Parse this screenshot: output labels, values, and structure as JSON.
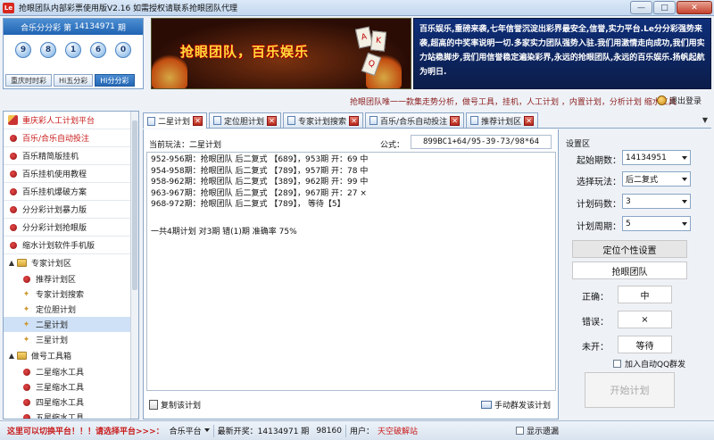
{
  "window": {
    "title": "抢眼团队内部彩票使用版V2.16  如需授权请联系抢眼团队代理",
    "icon_text": "Le",
    "minimize": "—",
    "maximize": "□",
    "close": "✕"
  },
  "lottery": {
    "name": "合乐分分彩",
    "period_prefix": "第",
    "period": "14134971",
    "period_suffix": "期",
    "numbers": [
      "9",
      "8",
      "1",
      "6",
      "0"
    ],
    "tabs": [
      {
        "label": "重庆时时彩",
        "active": false
      },
      {
        "label": "Hi五分彩",
        "active": false
      },
      {
        "label": "Hi分分彩",
        "active": true
      }
    ]
  },
  "banner": {
    "slogan": "抢眼团队，百乐娱乐",
    "cards": [
      "A",
      "K",
      "Q"
    ],
    "promo": "百乐娱乐,重磅来袭,七年信誉沉淀出彩界最安全,信誉,实力平台.Le分分彩强势来袭,超高的中奖率说明一切.多家实力团队强势入驻.我们用激情走向成功,我们用实力站稳脚步,我们用信誉稳定遍染彩界,永远的抢眼团队,永远的百乐娱乐.扬帆起航为明日."
  },
  "marquee": "抢眼团队唯一一款集走势分析，做号工具，挂机，人工计划 ，内置计划，分析计划   缩水工具",
  "logout_label": "退出登录",
  "sidebar": {
    "items": [
      {
        "label": "重庆彩人工计划平台",
        "icon": "pencil",
        "red": true
      },
      {
        "label": "百乐/合乐自动投注",
        "icon": "pin",
        "red": true
      },
      {
        "label": "百乐精简版挂机",
        "icon": "pin",
        "red": false
      },
      {
        "label": "百乐挂机使用教程",
        "icon": "pin",
        "red": false
      },
      {
        "label": "百乐挂机爆破方案",
        "icon": "pin",
        "red": false
      },
      {
        "label": "分分彩计划暴力版",
        "icon": "pin",
        "red": false
      },
      {
        "label": "分分彩计划抢眼版",
        "icon": "pin",
        "red": false
      },
      {
        "label": "缩水计划软件手机版",
        "icon": "pin",
        "red": false
      }
    ],
    "group_expert": {
      "label": "专家计划区",
      "toggle": "▲",
      "children": [
        {
          "label": "推荐计划区",
          "icon": "pin",
          "selected": false
        },
        {
          "label": "专家计划搜索",
          "icon": "star",
          "selected": false
        },
        {
          "label": "定位胆计划",
          "icon": "star",
          "selected": false
        },
        {
          "label": "二星计划",
          "icon": "star",
          "selected": true
        },
        {
          "label": "三星计划",
          "icon": "star",
          "selected": false
        }
      ]
    },
    "group_tools": {
      "label": "做号工具箱",
      "toggle": "▲",
      "children": [
        {
          "label": "二星缩水工具",
          "icon": "pin"
        },
        {
          "label": "三星缩水工具",
          "icon": "pin"
        },
        {
          "label": "四星缩水工具",
          "icon": "pin"
        },
        {
          "label": "五星缩水工具",
          "icon": "pin"
        }
      ]
    }
  },
  "tabs": [
    {
      "label": "二星计划",
      "active": true
    },
    {
      "label": "定位胆计划",
      "active": false
    },
    {
      "label": "专家计划搜索",
      "active": false
    },
    {
      "label": "百乐/合乐自动投注",
      "active": false
    },
    {
      "label": "推荐计划区",
      "active": false
    }
  ],
  "tabs_menu": "▼",
  "main": {
    "play_label": "当前玩法：二星计划",
    "formula_label": "公式：",
    "formula_value": "899BC1+64/95-39-73/98*64",
    "lines": [
      "952-956期：抢眼团队 后二复式 【689】，953期 开：69 中",
      "954-958期：抢眼团队 后二复式 【789】，957期 开：78 中",
      "958-962期：抢眼团队 后二复式 【389】，962期 开：99 中",
      "963-967期：抢眼团队 后二复式 【289】，967期 开：27 ×",
      "968-972期：抢眼团队 后二复式 【789】， 等待【5】"
    ],
    "summary": "一共4期计划 对3期 错(1)期 准确率 75%",
    "copy_label": "复制该计划",
    "send_label": "手动群发该计划"
  },
  "settings": {
    "title": "设置区",
    "rows": [
      {
        "label": "起始期数：",
        "value": "14134951"
      },
      {
        "label": "选择玩法：",
        "value": "后二复式"
      },
      {
        "label": "计划码数：",
        "value": "3"
      },
      {
        "label": "计划周期：",
        "value": "5"
      }
    ],
    "custom_btn": "定位个性设置",
    "name_value": "抢眼团队",
    "results": [
      {
        "label": "正确：",
        "value": "中"
      },
      {
        "label": "错误：",
        "value": "×"
      },
      {
        "label": "未开：",
        "value": "等待"
      }
    ],
    "qq_label": "加入自动QQ群发",
    "start_btn": "开始计划"
  },
  "status": {
    "warning": "这里可以切换平台！！！请选择平台>>>：",
    "platform": "合乐平台",
    "latest_label": "最新开奖：14134971 期",
    "latest_value": "98160",
    "user_label": "用户：",
    "user_value": "天空破解站",
    "topmost_label": "显示遗漏"
  }
}
